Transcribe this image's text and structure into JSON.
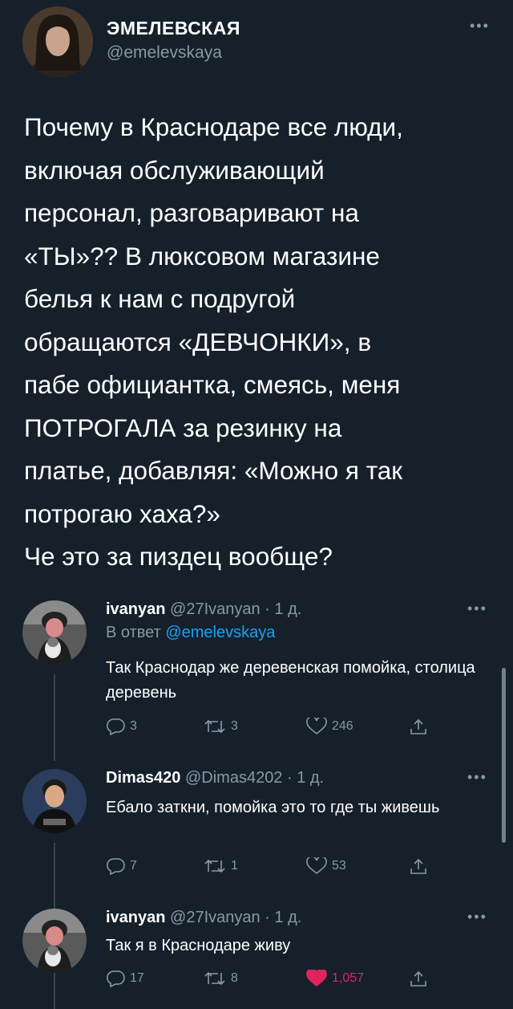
{
  "main_tweet": {
    "author_name": "ЭМЕЛЕВСКАЯ",
    "author_handle": "@emelevskaya",
    "text": "Почему в Краснодаре все люди,\nвключая обслуживающий\nперсонал, разговаривают на\n«ТЫ»?? В люксовом магазине\nбелья к нам с подругой\nобращаются «ДЕВЧОНКИ», в\nпабе официантка, смеясь, меня\nПОТРОГАЛА за резинку на\nплатье, добавляя: «Можно я так\nпотрогаю хаха?»\nЧе это за пиздец вообще?"
  },
  "replies": [
    {
      "name": "ivanyan",
      "meta": "@27Ivanyan · 1 д.",
      "reply_to_prefix": "В ответ ",
      "reply_to_handle": "@emelevskaya",
      "text": "Так Краснодар же деревенская помойка, столица деревень",
      "replies": "3",
      "retweets": "3",
      "likes": "246",
      "liked": false
    },
    {
      "name": "Dimas420",
      "meta": "@Dimas4202 · 1 д.",
      "text": "Ебало заткни, помойка это то где ты живешь",
      "replies": "7",
      "retweets": "1",
      "likes": "53",
      "liked": false
    },
    {
      "name": "ivanyan",
      "meta": "@27Ivanyan · 1 д.",
      "text": "Так я в Краснодаре живу",
      "replies": "17",
      "retweets": "8",
      "likes": "1,057",
      "liked": true
    }
  ],
  "colors": {
    "background": "#15202b",
    "secondary_text": "#8899a6",
    "link": "#1da1f2",
    "like_active": "#e0245e"
  },
  "icons": {
    "more": "more-dots-icon",
    "reply": "reply-bubble-icon",
    "retweet": "retweet-icon",
    "like": "heart-icon",
    "share": "share-icon"
  }
}
